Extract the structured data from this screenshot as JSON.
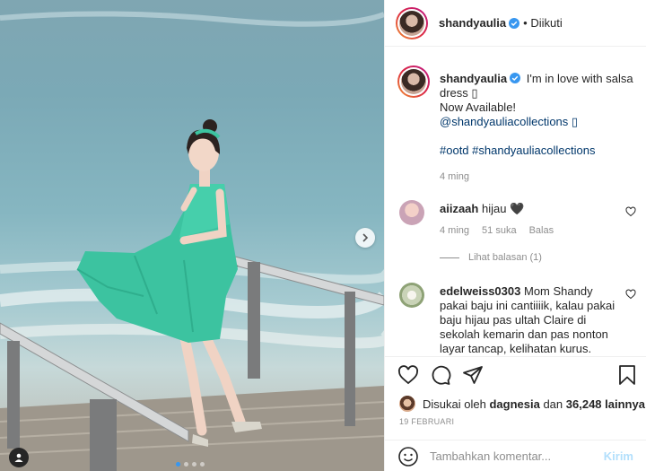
{
  "post": {
    "username": "shandyaulia",
    "follow_status": "Diikuti",
    "caption_lines": [
      "I'm in love with salsa",
      "dress ▯",
      "Now Available!",
      "@shandyauliacollections ▯"
    ],
    "hashtags": "#ootd #shandyauliacollections",
    "caption_time": "4 ming"
  },
  "comments": [
    {
      "username": "aiizaah",
      "text": "hijau 🖤",
      "time": "4 ming",
      "likes": "51 suka",
      "reply": "Balas",
      "view_replies": "Lihat balasan (1)"
    },
    {
      "username": "edelweiss0303",
      "lines": [
        "Mom Shandy",
        "pakai baju ini cantiiiik, kalau pakai",
        "baju hijau pas ultah Claire di",
        "sekolah kemarin dan pas nonton",
        "layar tancap, kelihatan kurus."
      ]
    }
  ],
  "likes": {
    "prefix": "Disukai oleh",
    "user": "dagnesia",
    "middle": "dan",
    "count": "36,248 lainnya"
  },
  "post_date": "19 FEBRUARI",
  "comment_box": {
    "placeholder": "Tambahkan komentar...",
    "post_label": "Kirim"
  },
  "carousel": {
    "slides": 4,
    "active_index": 0
  },
  "colors": {
    "verified": "#3897f0",
    "link": "#00376b",
    "meta": "#8e8e8e",
    "dress": "#3cc3a0"
  },
  "icons": [
    "verified-icon",
    "heart-icon",
    "comment-icon",
    "share-icon",
    "bookmark-icon",
    "chevron-right-icon",
    "user-tag-icon",
    "emoji-icon"
  ]
}
